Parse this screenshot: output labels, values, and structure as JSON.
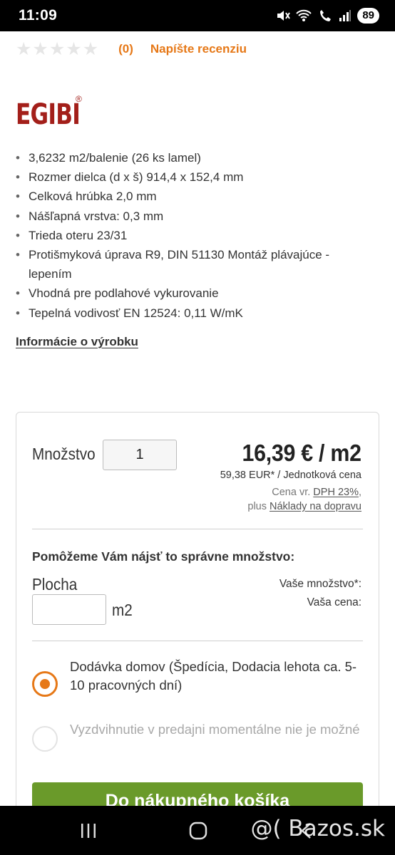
{
  "status_bar": {
    "time": "11:09",
    "battery": "89"
  },
  "rating": {
    "stars_filled": 0,
    "stars_total": 5,
    "count": "(0)",
    "review_link": "Napíšte recenziu"
  },
  "brand": {
    "name": "EGIBI",
    "reg": "®"
  },
  "features": [
    "3,6232 m2/balenie (26 ks lamel)",
    "Rozmer dielca (d x š) 914,4 x 152,4 mm",
    "Celková hrúbka 2,0 mm",
    "Nášľapná vrstva: 0,3 mm",
    "Trieda oteru 23/31",
    "Protišmyková úprava R9, DIN 51130 Montáž plávajúce - lepením",
    "Vhodná pre podlahové vykurovanie",
    "Tepelná vodivosť EN 12524: 0,11 W/mK"
  ],
  "info_link": "Informácie o výrobku",
  "purchase": {
    "qty_label": "Množstvo",
    "qty_value": "1",
    "price": "16,39 € / m2",
    "unit_price": "59,38 EUR* / Jednotková cena",
    "tax_prefix": "Cena vr. ",
    "tax_link": "DPH 23%",
    "tax_suffix": ",",
    "ship_prefix": "plus ",
    "ship_link": "Náklady na dopravu",
    "helper_title": "Pomôžeme Vám nájsť to správne množstvo:",
    "area_label": "Plocha",
    "area_value": "",
    "area_unit": "m2",
    "your_qty_label": "Vaše množstvo*:",
    "your_price_label": "Vaša cena:",
    "options": [
      {
        "label": "Dodávka domov (Špedícia, Dodacia lehota ca. 5-10 pracovných dní)",
        "selected": true,
        "enabled": true
      },
      {
        "label": "Vyzdvihnutie v predajni momentálne nie je možné",
        "selected": false,
        "enabled": false
      }
    ],
    "cart_button": "Do nákupného košíka"
  },
  "watermark": "@( Bazos.sk"
}
